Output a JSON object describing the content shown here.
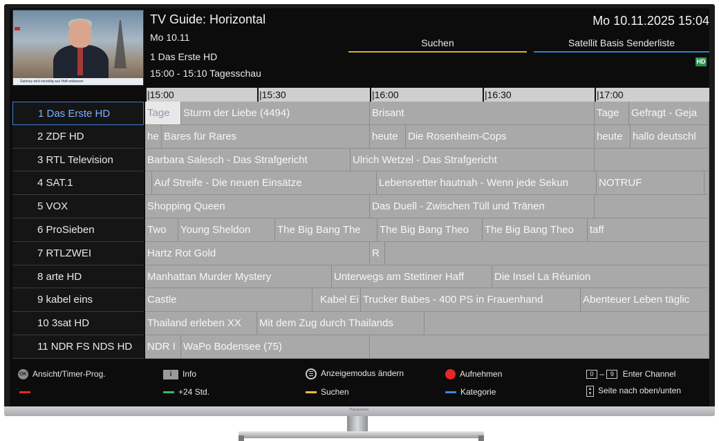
{
  "header": {
    "title": "TV Guide: Horizontal",
    "date": "Mo 10.11",
    "channel": "1 Das Erste HD",
    "program": "15:00 - 15:10  Tagesschau",
    "clock": "Mo 10.11.2025 15:04",
    "tab_search": "Suchen",
    "tab_list": "Satellit Basis Senderliste",
    "hd_badge": "HD",
    "preview_ticker": "Sarkozy wird vorzeitig aus Haft entlassen"
  },
  "timeline": [
    "|15:00",
    "|15:30",
    "|16:00",
    "|16:30",
    "|17:00"
  ],
  "channels": [
    {
      "name": "1 Das Erste HD",
      "selected": true,
      "programs": [
        "Tage",
        "Sturm der Liebe (4494)",
        "Brisant",
        "Tage",
        "Gefragt - Geja"
      ]
    },
    {
      "name": "2 ZDF HD",
      "programs": [
        "he",
        "Bares für Rares",
        "heute",
        "Die Rosenheim-Cops",
        "heute",
        "hallo deutschl"
      ]
    },
    {
      "name": "3 RTL Television",
      "programs": [
        "Barbara Salesch - Das Strafgericht",
        "Ulrich Wetzel - Das Strafgericht",
        ""
      ]
    },
    {
      "name": "4 SAT.1",
      "programs": [
        "",
        "Auf Streife - Die neuen Einsätze",
        "Lebensretter hautnah - Wenn jede Sekun",
        "NOTRUF",
        ""
      ]
    },
    {
      "name": "5 VOX",
      "programs": [
        "Shopping Queen",
        "Das Duell - Zwischen Tüll und Tränen",
        ""
      ]
    },
    {
      "name": "6 ProSieben",
      "programs": [
        "Two",
        "Young Sheldon",
        "The Big Bang The",
        "The Big Bang Theo",
        "The Big Bang Theo",
        "taff"
      ]
    },
    {
      "name": "7 RTLZWEI",
      "programs": [
        "Hartz Rot Gold",
        "R",
        ""
      ]
    },
    {
      "name": "8 arte HD",
      "programs": [
        "Manhattan Murder Mystery",
        "Unterwegs am Stettiner Haff",
        "Die Insel La Réunion"
      ]
    },
    {
      "name": "9 kabel eins",
      "programs": [
        "Castle",
        "Kabel Ei",
        "Trucker Babes - 400 PS in Frauenhand",
        "Abenteuer Leben täglic"
      ]
    },
    {
      "name": "10 3sat HD",
      "programs": [
        "Thailand erleben XX",
        "Mit dem Zug durch Thailands",
        ""
      ]
    },
    {
      "name": "11 NDR FS NDS HD",
      "programs": [
        "NDR I",
        "WaPo Bodensee (75)",
        ""
      ]
    }
  ],
  "footer": {
    "ok_label": "OK",
    "ok_text": "Ansicht/Timer-Prog.",
    "info_label": "i",
    "info_text": "Info",
    "mode_text": "Anzeigemodus ändern",
    "record_text": "Aufnehmen",
    "key_0": "0",
    "key_sep": "–",
    "key_9": "9",
    "enter_text": "Enter Channel",
    "green_text": "+24 Std.",
    "yellow_text": "Suchen",
    "blue_text": "Kategorie",
    "page_text": "Seite nach oben/unten",
    "colors": {
      "red": "#e82626",
      "green": "#2fbf5a",
      "yellow": "#e8c22a",
      "blue": "#3a86e0"
    }
  },
  "tv_brand": "Panasonic"
}
